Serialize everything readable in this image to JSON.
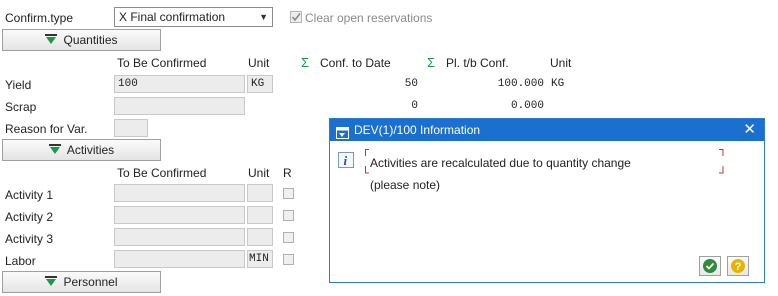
{
  "header": {
    "confirm_type_label": "Confirm.type",
    "confirm_type_value": "X Final confirmation",
    "clear_reservations_label": "Clear open reservations",
    "clear_reservations_checked": true
  },
  "quantities": {
    "button_label": "Quantities",
    "col_to_be_confirmed": "To Be Confirmed",
    "col_unit": "Unit",
    "col_conf_to_date": "Conf. to Date",
    "col_pl_tb_conf": "Pl. t/b Conf.",
    "col_unit2": "Unit",
    "rows": [
      {
        "label": "Yield",
        "value": "100",
        "unit": "KG",
        "conf_to_date": "50",
        "pl_tb_conf": "100.000",
        "unit2": "KG"
      },
      {
        "label": "Scrap",
        "value": "",
        "unit": "",
        "conf_to_date": "0",
        "pl_tb_conf": "0.000",
        "unit2": ""
      }
    ],
    "reason_label": "Reason for Var."
  },
  "activities": {
    "button_label": "Activities",
    "col_to_be_confirmed": "To Be Confirmed",
    "col_unit": "Unit",
    "col_r": "R",
    "rows": [
      {
        "label": "Activity 1",
        "unit": ""
      },
      {
        "label": "Activity 2",
        "unit": ""
      },
      {
        "label": "Activity 3",
        "unit": ""
      },
      {
        "label": "Labor",
        "unit": "MIN"
      }
    ]
  },
  "personnel": {
    "button_label": "Personnel"
  },
  "dialog": {
    "title": "DEV(1)/100 Information",
    "message": "Activities are recalculated due to quantity change",
    "note": "(please note)",
    "icon": "info-icon",
    "buttons": [
      "confirm-icon",
      "help-icon"
    ]
  },
  "colors": {
    "dialog_title_bg": "#1b6fce",
    "sigma": "#1a9a4a",
    "confirm_green": "#2e8b3c",
    "help_yellow": "#e8b400"
  }
}
